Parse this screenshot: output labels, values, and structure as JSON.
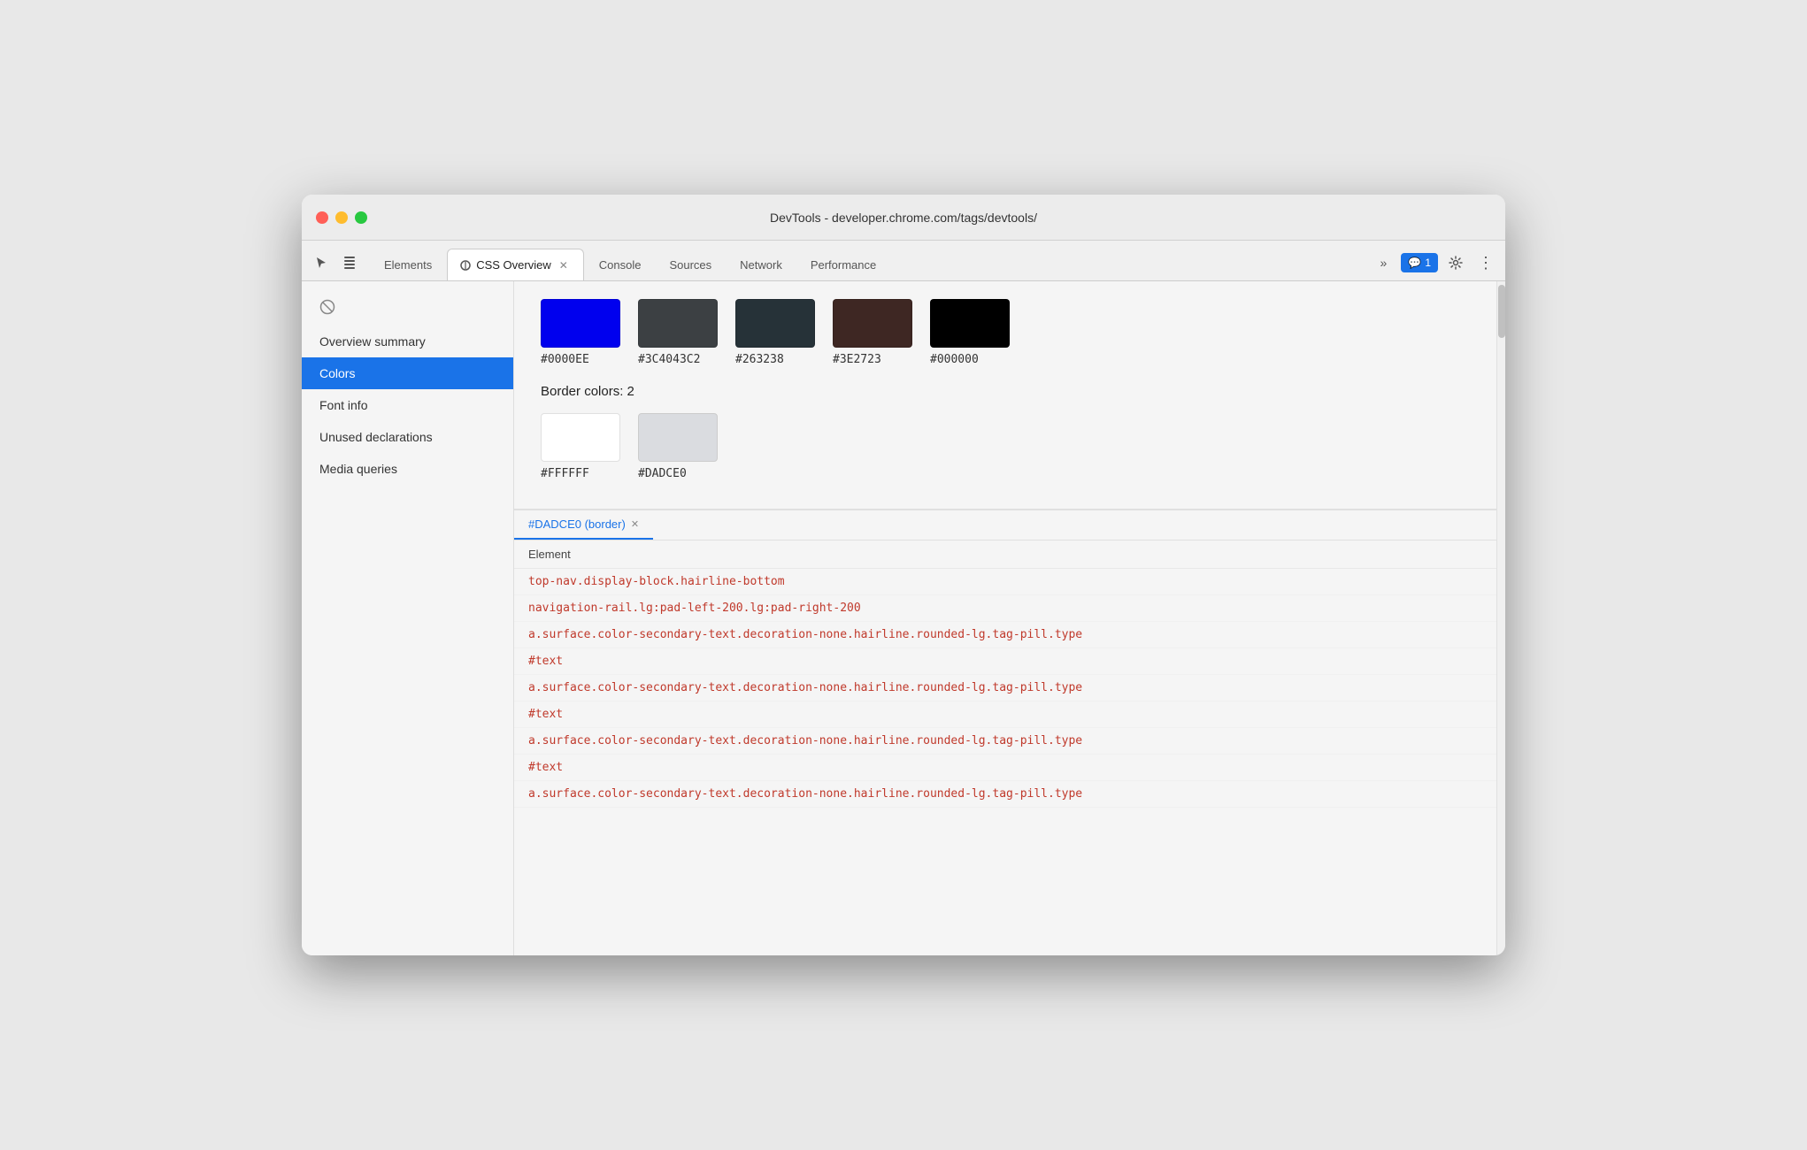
{
  "window": {
    "title": "DevTools - developer.chrome.com/tags/devtools/"
  },
  "tabs": [
    {
      "id": "elements",
      "label": "Elements",
      "active": false,
      "closeable": false
    },
    {
      "id": "css-overview",
      "label": "CSS Overview",
      "active": true,
      "closeable": true,
      "has_icon": true
    },
    {
      "id": "console",
      "label": "Console",
      "active": false,
      "closeable": false
    },
    {
      "id": "sources",
      "label": "Sources",
      "active": false,
      "closeable": false
    },
    {
      "id": "network",
      "label": "Network",
      "active": false,
      "closeable": false
    },
    {
      "id": "performance",
      "label": "Performance",
      "active": false,
      "closeable": false
    }
  ],
  "tab_overflow": "»",
  "badge": {
    "icon": "💬",
    "count": "1"
  },
  "sidebar": {
    "items": [
      {
        "id": "overview-summary",
        "label": "Overview summary",
        "active": false
      },
      {
        "id": "colors",
        "label": "Colors",
        "active": true
      },
      {
        "id": "font-info",
        "label": "Font info",
        "active": false
      },
      {
        "id": "unused-declarations",
        "label": "Unused declarations",
        "active": false
      },
      {
        "id": "media-queries",
        "label": "Media queries",
        "active": false
      }
    ]
  },
  "colors_section": {
    "text_colors_label": "",
    "swatches": [
      {
        "id": "color1",
        "hex": "#0000EE",
        "css": "#0000EE"
      },
      {
        "id": "color2",
        "hex": "#3C4043C2",
        "css": "#3C4043C2"
      },
      {
        "id": "color3",
        "hex": "#263238",
        "css": "#263238"
      },
      {
        "id": "color4",
        "hex": "#3E2723",
        "css": "#3E2723"
      },
      {
        "id": "color5",
        "hex": "#000000",
        "css": "#000000"
      }
    ],
    "border_colors_heading": "Border colors: 2",
    "border_swatches": [
      {
        "id": "border1",
        "hex": "#FFFFFF",
        "css": "#FFFFFF"
      },
      {
        "id": "border2",
        "hex": "#DADCE0",
        "css": "#DADCE0"
      }
    ]
  },
  "elements_panel": {
    "active_tab_label": "#DADCE0 (border)",
    "column_header": "Element",
    "rows": [
      {
        "id": "row1",
        "text": "top-nav.display-block.hairline-bottom",
        "is_text_node": false
      },
      {
        "id": "row2",
        "text": "navigation-rail.lg:pad-left-200.lg:pad-right-200",
        "is_text_node": false
      },
      {
        "id": "row3",
        "text": "a.surface.color-secondary-text.decoration-none.hairline.rounded-lg.tag-pill.type",
        "is_text_node": false
      },
      {
        "id": "row4",
        "text": "#text",
        "is_text_node": true
      },
      {
        "id": "row5",
        "text": "a.surface.color-secondary-text.decoration-none.hairline.rounded-lg.tag-pill.type",
        "is_text_node": false
      },
      {
        "id": "row6",
        "text": "#text",
        "is_text_node": true
      },
      {
        "id": "row7",
        "text": "a.surface.color-secondary-text.decoration-none.hairline.rounded-lg.tag-pill.type",
        "is_text_node": false
      },
      {
        "id": "row8",
        "text": "#text",
        "is_text_node": true
      },
      {
        "id": "row9",
        "text": "a.surface.color-secondary-text.decoration-none.hairline.rounded-lg.tag-pill.type",
        "is_text_node": false
      }
    ]
  },
  "icons": {
    "cursor": "⊘",
    "layers": "⧉",
    "settings": "⚙",
    "more": "⋮",
    "no_results": "⊘"
  },
  "colors": {
    "blue_accent": "#1a73e8",
    "active_sidebar_bg": "#1a73e8",
    "element_text_color": "#c0392b"
  }
}
